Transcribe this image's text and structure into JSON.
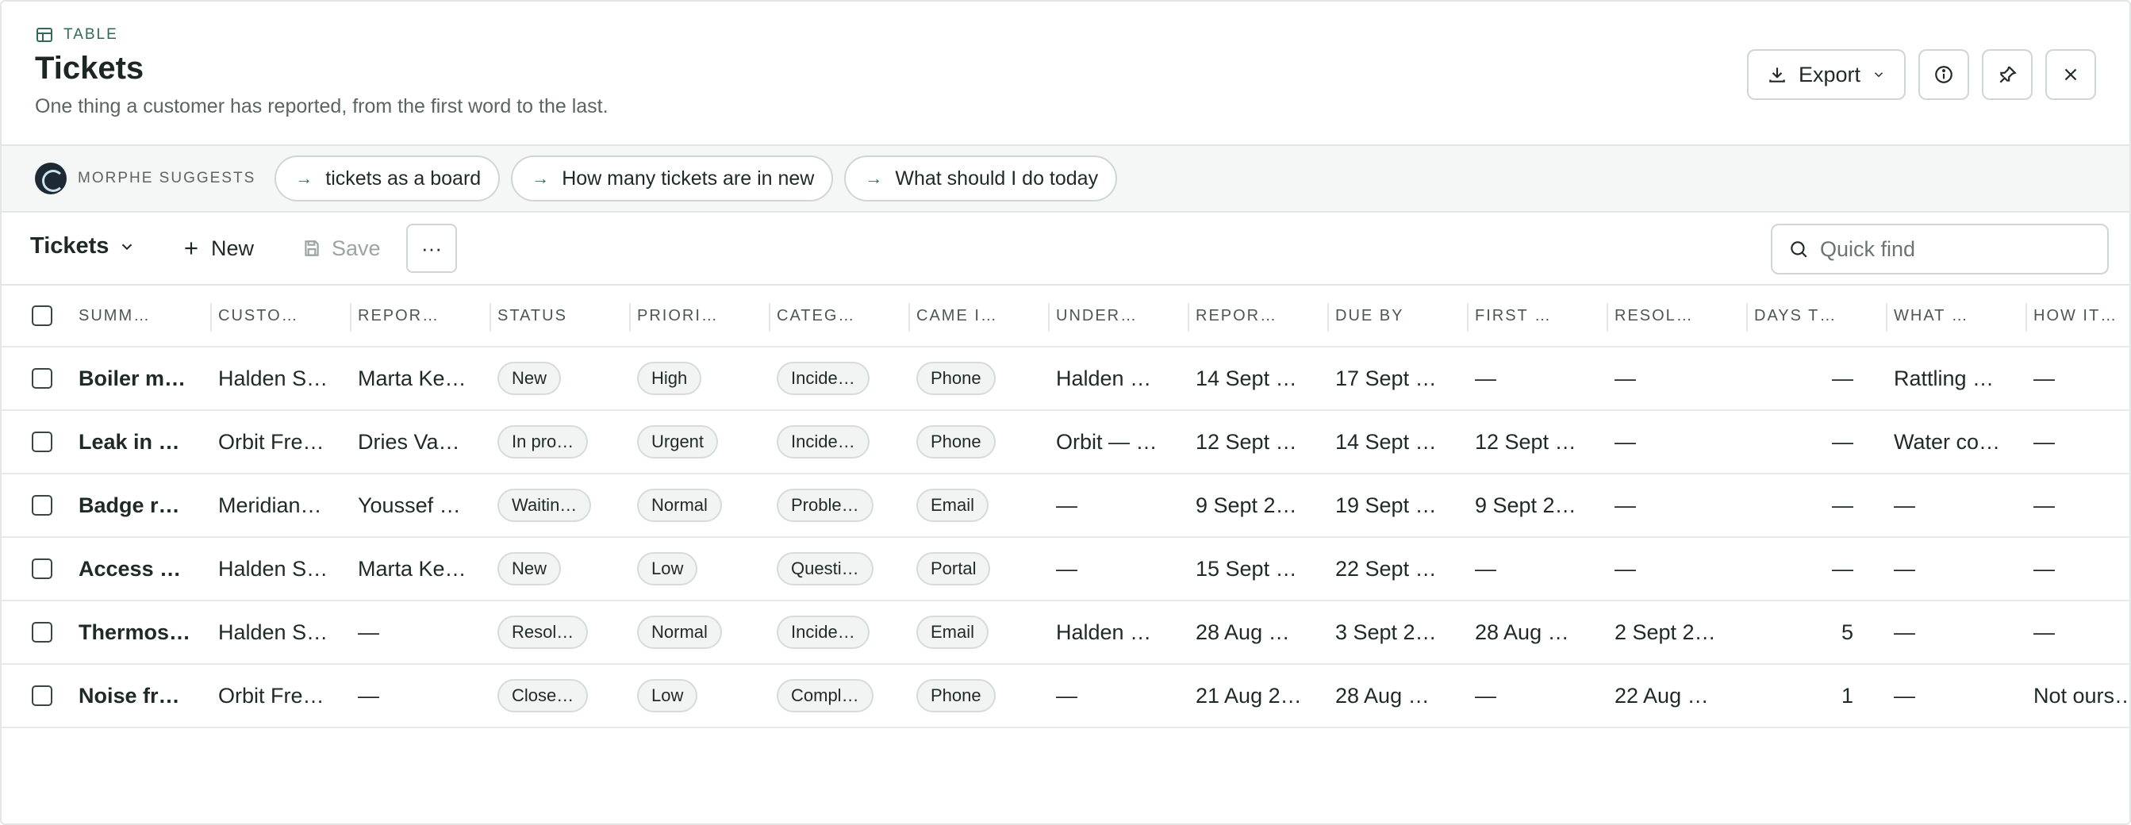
{
  "header": {
    "kicker": "TABLE",
    "title": "Tickets",
    "subtitle": "One thing a customer has reported, from the first word to the last.",
    "export_label": "Export"
  },
  "suggest": {
    "label": "MORPHE SUGGESTS",
    "chips": [
      "tickets as a board",
      "How many tickets are in new",
      "What should I do today"
    ]
  },
  "toolbar": {
    "view_label": "Tickets",
    "new_label": "New",
    "save_label": "Save",
    "more_label": "···",
    "quickfind_placeholder": "Quick find"
  },
  "table": {
    "columns": [
      "SUMM…",
      "CUSTO…",
      "REPOR…",
      "STATUS",
      "PRIORI…",
      "CATEG…",
      "CAME I…",
      "UNDER…",
      "REPOR…",
      "DUE BY",
      "FIRST …",
      "RESOL…",
      "DAYS T…",
      "WHAT …",
      "HOW IT…"
    ],
    "rows": [
      [
        "Boiler m…",
        "Halden S…",
        "Marta Ke…",
        "New",
        "High",
        "Incide…",
        "Phone",
        "Halden …",
        "14 Sept …",
        "17 Sept …",
        "—",
        "—",
        "—",
        "Rattling …",
        "—"
      ],
      [
        "Leak in …",
        "Orbit Fre…",
        "Dries Va…",
        "In pro…",
        "Urgent",
        "Incide…",
        "Phone",
        "Orbit — …",
        "12 Sept …",
        "14 Sept …",
        "12 Sept …",
        "—",
        "—",
        "Water co…",
        "—"
      ],
      [
        "Badge r…",
        "Meridian…",
        "Youssef …",
        "Waitin…",
        "Normal",
        "Proble…",
        "Email",
        "—",
        "9 Sept 2…",
        "19 Sept …",
        "9 Sept 2…",
        "—",
        "—",
        "—",
        "—"
      ],
      [
        "Access …",
        "Halden S…",
        "Marta Ke…",
        "New",
        "Low",
        "Questi…",
        "Portal",
        "—",
        "15 Sept …",
        "22 Sept …",
        "—",
        "—",
        "—",
        "—",
        "—"
      ],
      [
        "Thermos…",
        "Halden S…",
        "—",
        "Resol…",
        "Normal",
        "Incide…",
        "Email",
        "Halden …",
        "28 Aug …",
        "3 Sept 2…",
        "28 Aug …",
        "2 Sept 2…",
        "5",
        "—",
        "—"
      ],
      [
        "Noise fr…",
        "Orbit Fre…",
        "—",
        "Close…",
        "Low",
        "Compl…",
        "Phone",
        "—",
        "21 Aug 2…",
        "28 Aug …",
        "—",
        "22 Aug …",
        "1",
        "—",
        "Not ours…"
      ]
    ]
  }
}
